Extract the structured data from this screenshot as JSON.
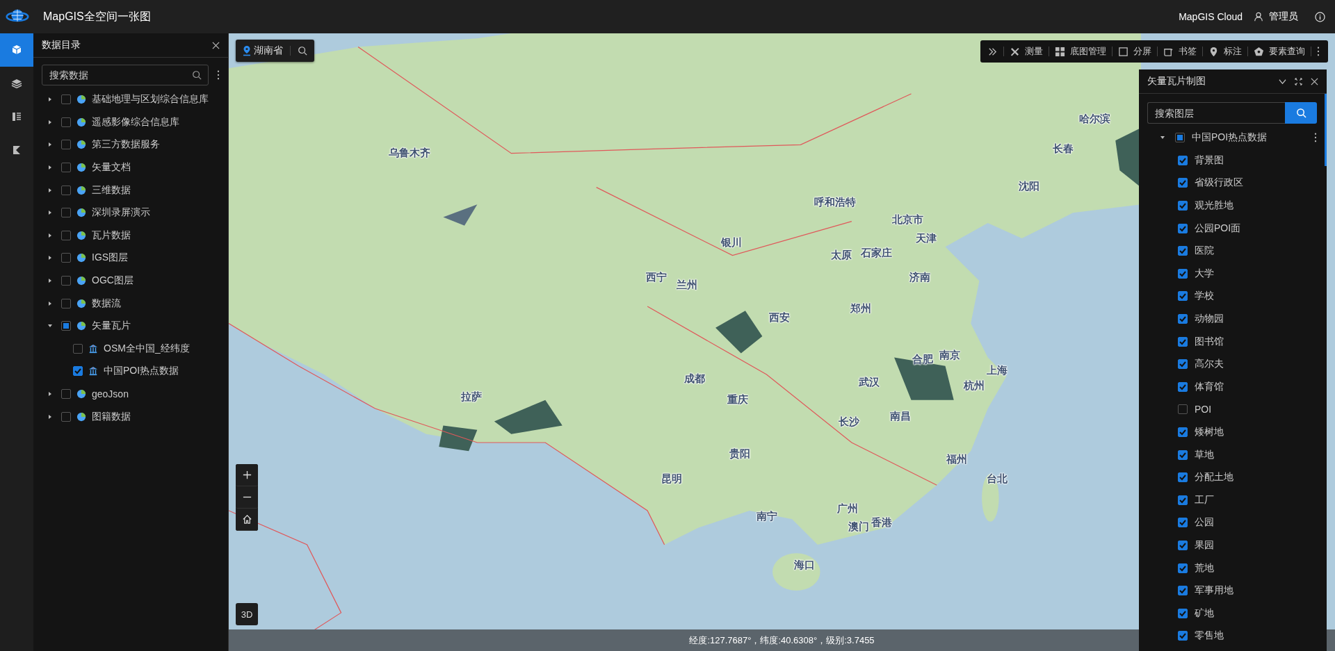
{
  "header": {
    "title": "MapGIS全空间一张图",
    "cloud_label": "MapGIS Cloud",
    "user": "管理员"
  },
  "rail": [
    {
      "selected": true
    },
    {
      "selected": false
    },
    {
      "selected": false
    },
    {
      "selected": false
    }
  ],
  "catalog": {
    "title": "数据目录",
    "search_placeholder": "搜索数据",
    "items": [
      {
        "label": "基础地理与区划综合信息库",
        "checked": false,
        "indeterminate": false,
        "expanded": false
      },
      {
        "label": "遥感影像综合信息库",
        "checked": false,
        "indeterminate": false,
        "expanded": false
      },
      {
        "label": "第三方数据服务",
        "checked": false,
        "indeterminate": false,
        "expanded": false
      },
      {
        "label": "矢量文档",
        "checked": false,
        "indeterminate": false,
        "expanded": false
      },
      {
        "label": "三维数据",
        "checked": false,
        "indeterminate": false,
        "expanded": false
      },
      {
        "label": "深圳录屏演示",
        "checked": false,
        "indeterminate": false,
        "expanded": false
      },
      {
        "label": "瓦片数据",
        "checked": false,
        "indeterminate": false,
        "expanded": false
      },
      {
        "label": "IGS图层",
        "checked": false,
        "indeterminate": false,
        "expanded": false
      },
      {
        "label": "OGC图层",
        "checked": false,
        "indeterminate": false,
        "expanded": false
      },
      {
        "label": "数据流",
        "checked": false,
        "indeterminate": false,
        "expanded": false
      },
      {
        "label": "矢量瓦片",
        "checked": false,
        "indeterminate": true,
        "expanded": true,
        "children": [
          {
            "label": "OSM全中国_经纬度",
            "checked": false
          },
          {
            "label": "中国POI热点数据",
            "checked": true
          }
        ]
      },
      {
        "label": "geoJson",
        "checked": false,
        "indeterminate": false,
        "expanded": false
      },
      {
        "label": "图籍数据",
        "checked": false,
        "indeterminate": false,
        "expanded": false
      }
    ]
  },
  "location": {
    "label": "湖南省"
  },
  "toolbar": [
    {
      "label": "测量"
    },
    {
      "label": "底图管理"
    },
    {
      "label": "分屏"
    },
    {
      "label": "书签"
    },
    {
      "label": "标注"
    },
    {
      "label": "要素查询"
    }
  ],
  "layers_panel": {
    "title": "矢量瓦片制图",
    "search_placeholder": "搜索图层",
    "root": {
      "label": "中国POI热点数据",
      "checked": false,
      "indeterminate": true,
      "expanded": true,
      "children": [
        {
          "label": "背景图",
          "checked": true
        },
        {
          "label": "省级行政区",
          "checked": true
        },
        {
          "label": "观光胜地",
          "checked": true
        },
        {
          "label": "公园POI面",
          "checked": true
        },
        {
          "label": "医院",
          "checked": true
        },
        {
          "label": "大学",
          "checked": true
        },
        {
          "label": "学校",
          "checked": true
        },
        {
          "label": "动物园",
          "checked": true
        },
        {
          "label": "图书馆",
          "checked": true
        },
        {
          "label": "高尔夫",
          "checked": true
        },
        {
          "label": "体育馆",
          "checked": true
        },
        {
          "label": "POI",
          "checked": false
        },
        {
          "label": "矮树地",
          "checked": true
        },
        {
          "label": "草地",
          "checked": true
        },
        {
          "label": "分配土地",
          "checked": true
        },
        {
          "label": "工厂",
          "checked": true
        },
        {
          "label": "公园",
          "checked": true
        },
        {
          "label": "果园",
          "checked": true
        },
        {
          "label": "荒地",
          "checked": true
        },
        {
          "label": "军事用地",
          "checked": true
        },
        {
          "label": "矿地",
          "checked": true
        },
        {
          "label": "零售地",
          "checked": true
        }
      ]
    }
  },
  "map_labels": [
    "乌鲁木齐",
    "哈尔滨",
    "长春",
    "沈阳",
    "呼和浩特",
    "北京市",
    "天津",
    "银川",
    "太原",
    "石家庄",
    "西宁",
    "兰州",
    "济南",
    "西安",
    "郑州",
    "合肥",
    "南京",
    "上海",
    "成都",
    "武汉",
    "杭州",
    "拉萨",
    "重庆",
    "长沙",
    "南昌",
    "福州",
    "贵阳",
    "昆明",
    "台北",
    "南宁",
    "广州",
    "香港",
    "澳门",
    "海口"
  ],
  "map_controls": {
    "mode_label": "3D"
  },
  "status_bar": "经度:127.7687°，纬度:40.6308°，级别:3.7455"
}
